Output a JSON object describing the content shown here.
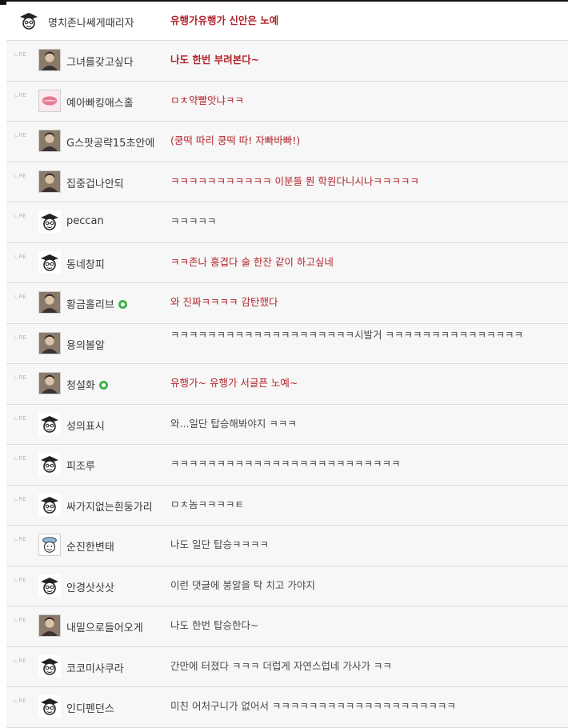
{
  "comments": [
    {
      "nick": "명치존나쎄게때리자",
      "text": "유행가유행가 신안은 노예",
      "style": "red bold",
      "avatar": "default-avatar-icon",
      "badge": false,
      "first": true
    },
    {
      "nick": "그녀를갖고싶다",
      "text": "나도 한번 부려본다~",
      "style": "red bold",
      "avatar": "photo-avatar-icon",
      "badge": false
    },
    {
      "nick": "예아빠킹애스홀",
      "text": "ㅁㅊ약빨앗냐ㅋㅋ",
      "style": "red",
      "avatar": "lips-avatar-icon",
      "badge": false
    },
    {
      "nick": "G스팟공략15초안에",
      "text": "(쿵떡 따리 쿵떡 따! 자빠바빠!)",
      "style": "red",
      "avatar": "photo-avatar-icon",
      "badge": false
    },
    {
      "nick": "집중겁나안되",
      "text": "ㅋㅋㅋㅋㅋㅋㅋㅋㅋㅋㅋ 이분들 뭔 학원다니시나ㅋㅋㅋㅋㅋ",
      "style": "red",
      "avatar": "photo-avatar-icon",
      "badge": false
    },
    {
      "nick": "peccan",
      "text": "ㅋㅋㅋㅋㅋ",
      "style": "plain",
      "avatar": "default-avatar-icon",
      "badge": false
    },
    {
      "nick": "동네창피",
      "text": "ㅋㅋ존나 흥겹다 술 한잔 같이 하고싶네",
      "style": "red",
      "avatar": "default-avatar-icon",
      "badge": false
    },
    {
      "nick": "황금홀리브",
      "text": "와 진짜ㅋㅋㅋㅋ 감탄했다",
      "style": "red",
      "avatar": "photo-avatar-icon",
      "badge": true
    },
    {
      "nick": "용의볼알",
      "text": "ㅋㅋㅋㅋㅋㅋㅋㅋㅋㅋㅋㅋㅋㅋㅋㅋㅋㅋㅋㅋ시발거 ㅋㅋㅋㅋㅋㅋㅋㅋㅋㅋㅋㅋㅋㅋㅋ",
      "style": "plain wrap",
      "avatar": "photo-avatar-icon",
      "badge": false
    },
    {
      "nick": "청설화",
      "text": "유행가~ 유행가 서글픈 노예~",
      "style": "red",
      "avatar": "photo-avatar-icon",
      "badge": true
    },
    {
      "nick": "성의표시",
      "text": "와...일단 탑승해봐야지 ㅋㅋㅋ",
      "style": "plain",
      "avatar": "default-avatar-icon",
      "badge": false
    },
    {
      "nick": "피조루",
      "text": "ㅋㅋㅋㅋㅋㅋㅋㅋㅋㅋㅋㅋㅋㅋㅋㅋㅋㅋㅋㅋㅋㅋㅋㅋㅋ",
      "style": "plain",
      "avatar": "default-avatar-icon",
      "badge": false
    },
    {
      "nick": "싸가지없는흰둥가리",
      "text": "ㅁㅊ놈ㅋㅋㅋㅋㅌ",
      "style": "plain",
      "avatar": "default-avatar-icon",
      "badge": false
    },
    {
      "nick": "순진한변태",
      "text": "나도 일단 탑승ㅋㅋㅋㅋ",
      "style": "plain",
      "avatar": "cartoon-avatar-icon",
      "badge": false
    },
    {
      "nick": "안경삿삿삿",
      "text": "이런 댓글에 붕알을 탁 치고 가야지",
      "style": "plain",
      "avatar": "default-avatar-icon",
      "badge": false
    },
    {
      "nick": "내밑으로들어오게",
      "text": "나도 한번 탑승한다~",
      "style": "plain",
      "avatar": "photo-avatar-icon",
      "badge": false
    },
    {
      "nick": "코코미사쿠라",
      "text": "간만에 터졌다 ㅋㅋㅋ 더럽게 자연스럽네 가사가 ㅋㅋ",
      "style": "plain",
      "avatar": "default-avatar-icon",
      "badge": false
    },
    {
      "nick": "인디펜던스",
      "text": "미친 어처구니가 없어서 ㅋㅋㅋㅋㅋㅋㅋㅋㅋㅋㅋㅋㅋㅋㅋㅋㅋㅋㅋㅋ",
      "style": "plain",
      "avatar": "default-avatar-icon",
      "badge": false
    }
  ],
  "reply_marker": "ㄴRE",
  "colors": {
    "accent_red": "#b2262d",
    "text_gray": "#4a4a4a",
    "row_bg": "#f7f7f7"
  }
}
